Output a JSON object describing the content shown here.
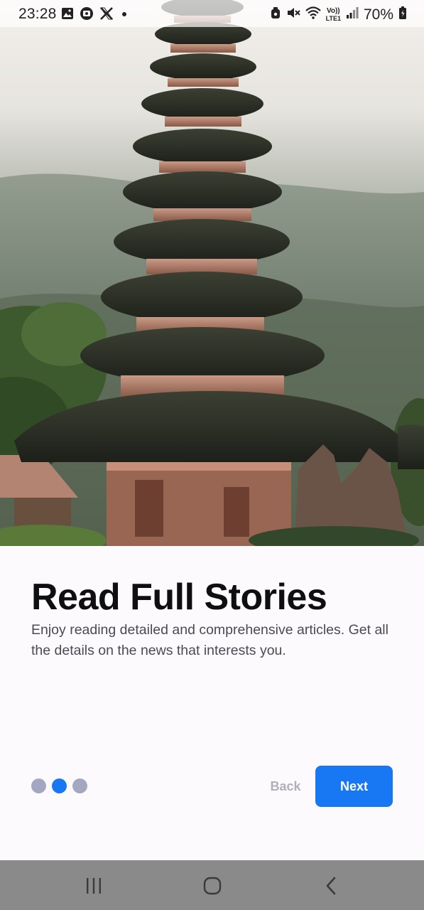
{
  "status_bar": {
    "time": "23:28",
    "battery": "70%",
    "left_icons": [
      "gallery-icon",
      "screen-record-icon",
      "x-logo-icon",
      "notification-dot-icon"
    ],
    "right_icons": [
      "alarm-icon",
      "mute-icon",
      "wifi-icon",
      "volte-icon",
      "signal-icon",
      "battery-icon"
    ],
    "volte_label_top": "Vo))",
    "volte_label_bottom": "LTE1"
  },
  "hero": {
    "image": "temple-pagoda-photo"
  },
  "onboarding": {
    "title": "Read Full Stories",
    "description": "Enjoy reading detailed and comprehensive articles. Get all the details on the news that interests you.",
    "page_count": 3,
    "active_page": 2,
    "back_label": "Back",
    "next_label": "Next"
  },
  "colors": {
    "accent": "#1877f2",
    "dot_inactive": "#a3a8c0",
    "back_text": "#b0b0b8",
    "title": "#0f0f12",
    "body": "#4a4a55",
    "nav_bar": "#8a8a8a"
  },
  "nav_bar": {
    "buttons": [
      "recents-icon",
      "home-icon",
      "back-icon"
    ]
  }
}
